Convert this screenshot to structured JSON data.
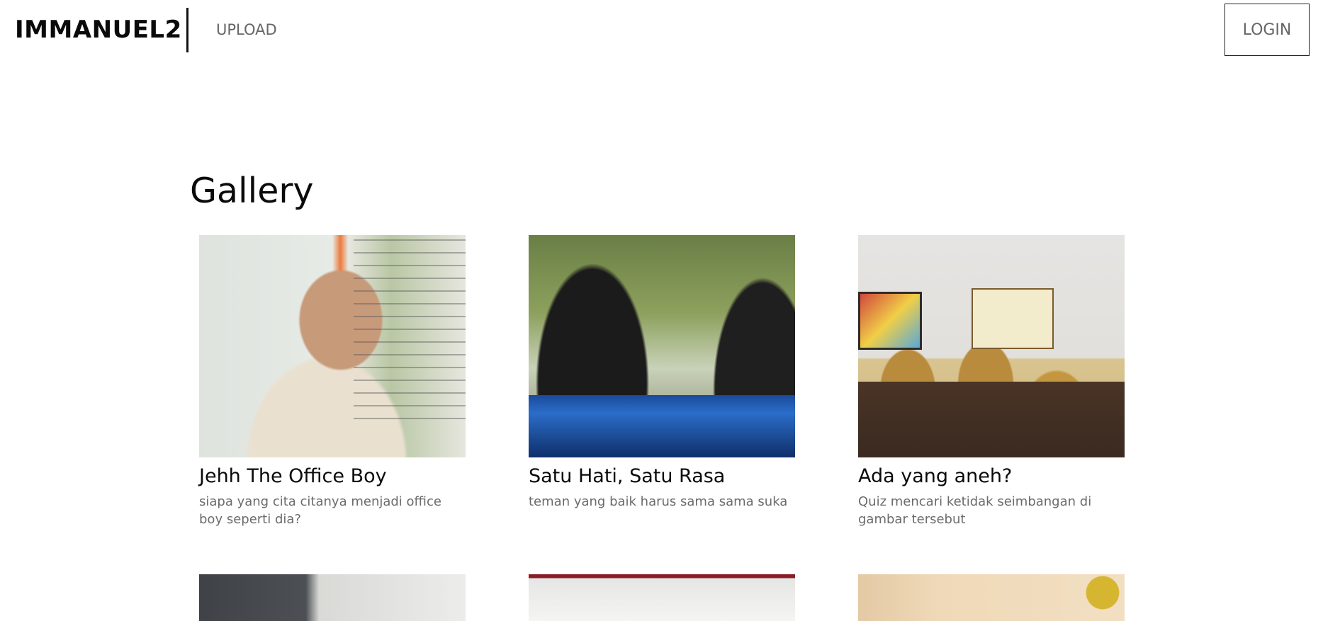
{
  "header": {
    "brand": "IMMANUEL2",
    "nav_upload": "UPLOAD",
    "login_label": "LOGIN"
  },
  "gallery": {
    "title": "Gallery",
    "items": [
      {
        "title": "Jehh The Office Boy",
        "description": "siapa yang cita citanya menjadi office boy seperti dia?"
      },
      {
        "title": "Satu Hati, Satu Rasa",
        "description": "teman yang baik harus sama sama suka"
      },
      {
        "title": "Ada yang aneh?",
        "description": "Quiz mencari ketidak seimbangan di gambar tersebut"
      }
    ]
  },
  "colors": {
    "text_primary": "#0a0a0a",
    "text_muted": "#6b6b6b",
    "nav_link": "#666666",
    "border": "#222222",
    "background": "#ffffff"
  }
}
